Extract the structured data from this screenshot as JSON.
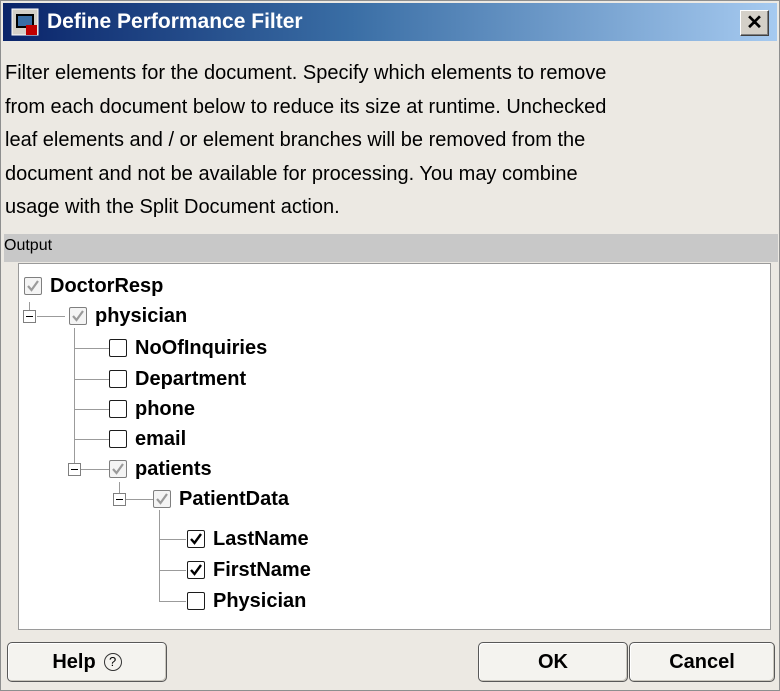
{
  "window": {
    "title": "Define Performance Filter",
    "close_glyph": "✕"
  },
  "description_lines": [
    "Filter elements for the document. Specify which elements to remove",
    "from each document below to reduce its size at runtime. Unchecked",
    "leaf elements and / or element branches will be removed from the",
    "document and not be available for processing. You may combine",
    "usage with the Split Document action."
  ],
  "section": {
    "label": "Output"
  },
  "tree": [
    {
      "label": "DoctorResp",
      "state": "partial"
    },
    {
      "label": "physician",
      "state": "partial"
    },
    {
      "label": "NoOfInquiries",
      "state": "unchecked"
    },
    {
      "label": "Department",
      "state": "unchecked"
    },
    {
      "label": "phone",
      "state": "unchecked"
    },
    {
      "label": "email",
      "state": "unchecked"
    },
    {
      "label": "patients",
      "state": "partial"
    },
    {
      "label": "PatientData",
      "state": "partial"
    },
    {
      "label": "LastName",
      "state": "checked"
    },
    {
      "label": "FirstName",
      "state": "checked"
    },
    {
      "label": "Physician",
      "state": "unchecked"
    }
  ],
  "buttons": {
    "help": "Help",
    "help_icon": "?",
    "ok": "OK",
    "cancel": "Cancel"
  }
}
